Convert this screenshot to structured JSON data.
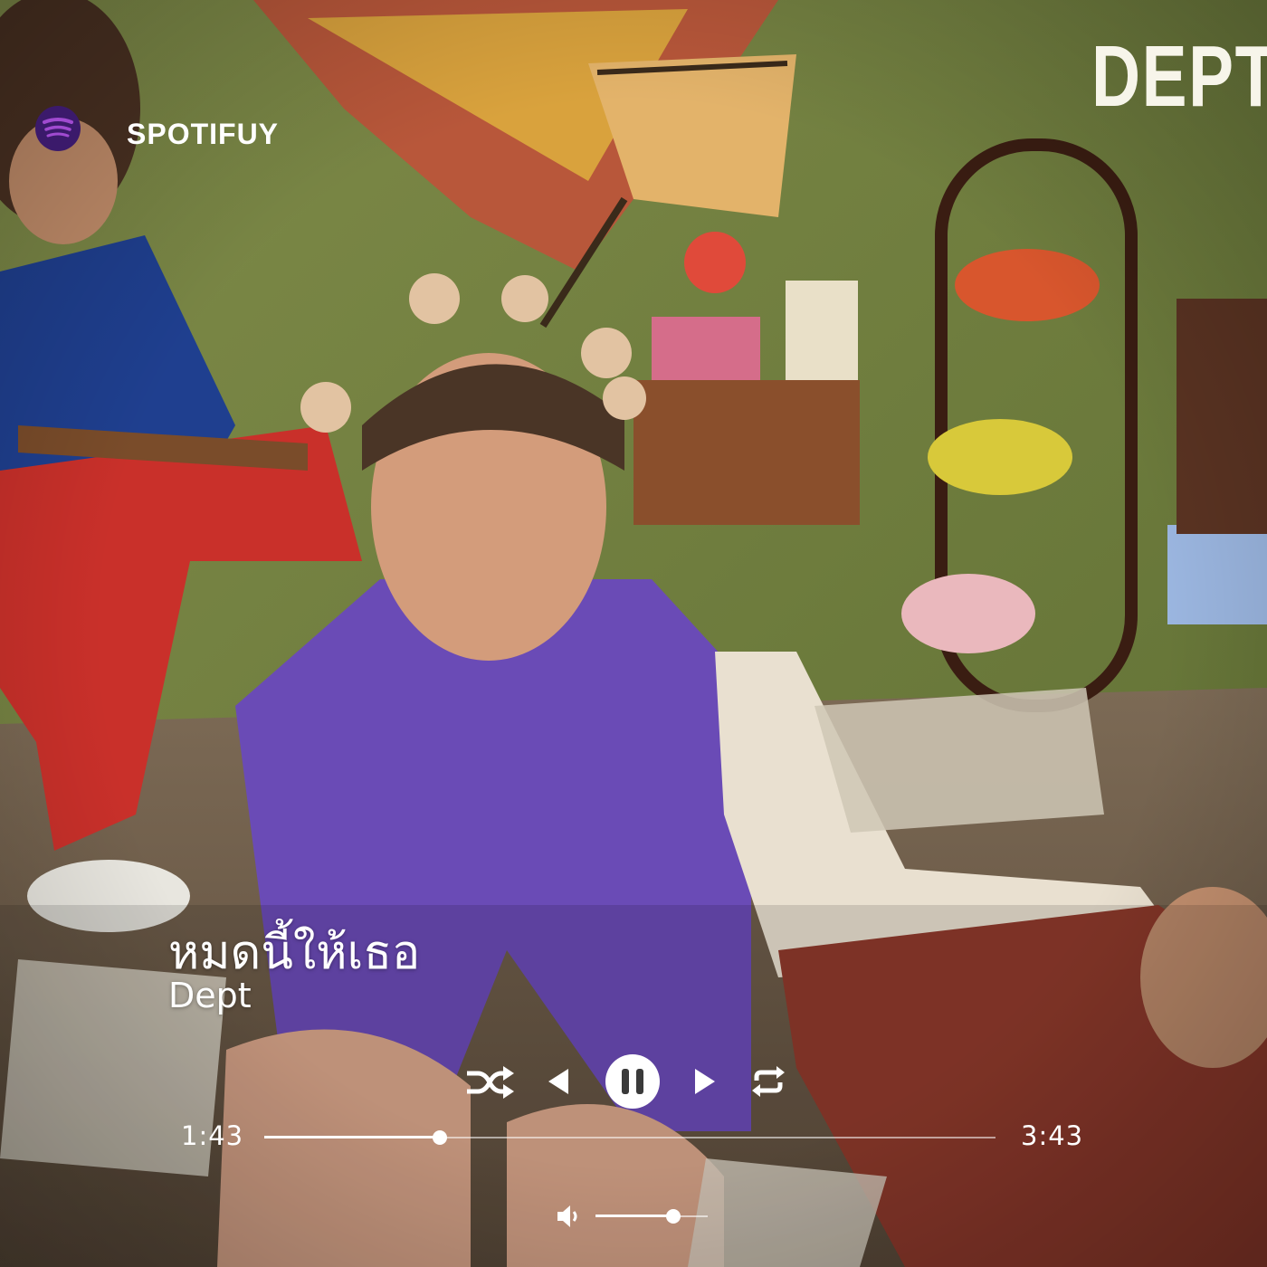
{
  "app": {
    "name": "SPOTIFUY",
    "logo_icon": "spotify-logo-icon",
    "accent": "#3b1a6b"
  },
  "album": {
    "wordmark": "DEPT"
  },
  "now_playing": {
    "title": "หมดนี้ให้เธอ",
    "artist": "Dept"
  },
  "controls": {
    "shuffle_icon": "shuffle-icon",
    "previous_icon": "previous-icon",
    "pause_icon": "pause-icon",
    "next_icon": "next-icon",
    "repeat_icon": "repeat-icon"
  },
  "progress": {
    "current_time": "1:43",
    "total_time": "3:43",
    "fraction": 0.24
  },
  "volume": {
    "icon": "volume-icon",
    "fraction": 0.69
  }
}
